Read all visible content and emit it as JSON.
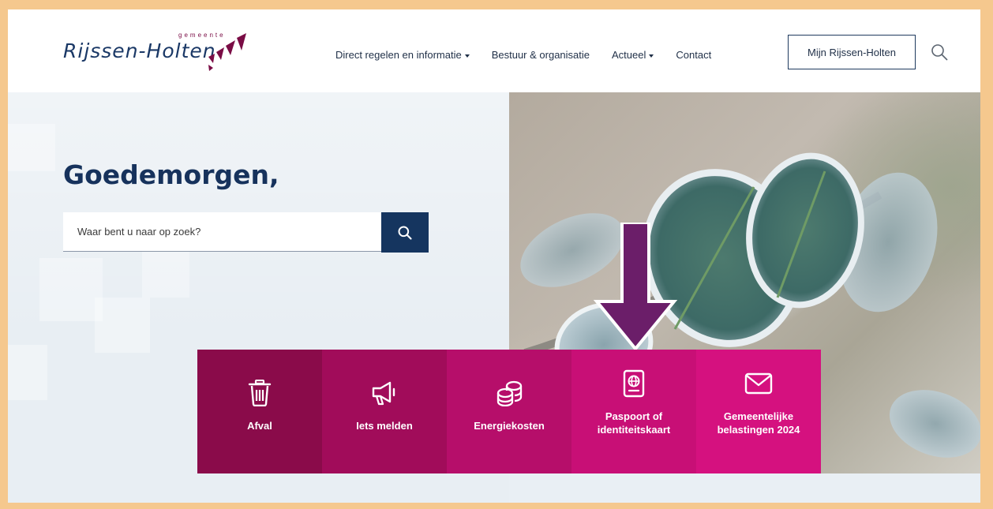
{
  "header": {
    "logo": {
      "small": "gemeente",
      "name": "Rijssen-Holten"
    },
    "nav": [
      {
        "label": "Direct regelen en informatie",
        "dropdown": true
      },
      {
        "label": "Bestuur & organisatie",
        "dropdown": false
      },
      {
        "label": "Actueel",
        "dropdown": true
      },
      {
        "label": "Contact",
        "dropdown": false
      }
    ],
    "account_button": "Mijn Rijssen-Holten",
    "search_icon": "search-icon"
  },
  "hero": {
    "greeting": "Goedemorgen,",
    "search": {
      "placeholder": "Waar bent u naar op zoek?",
      "value": ""
    }
  },
  "quick_links": [
    {
      "label": "Afval",
      "icon": "trash-icon"
    },
    {
      "label": "Iets melden",
      "icon": "megaphone-icon"
    },
    {
      "label": "Energiekosten",
      "icon": "coins-icon"
    },
    {
      "label": "Paspoort of identiteitskaart",
      "icon": "passport-icon"
    },
    {
      "label": "Gemeentelijke belastingen 2024",
      "icon": "envelope-icon"
    }
  ],
  "colors": {
    "brand_navy": "#15355f",
    "brand_magenta": "#c80f76",
    "frame": "#f5c88e",
    "annotation_arrow": "#6b1e69"
  }
}
